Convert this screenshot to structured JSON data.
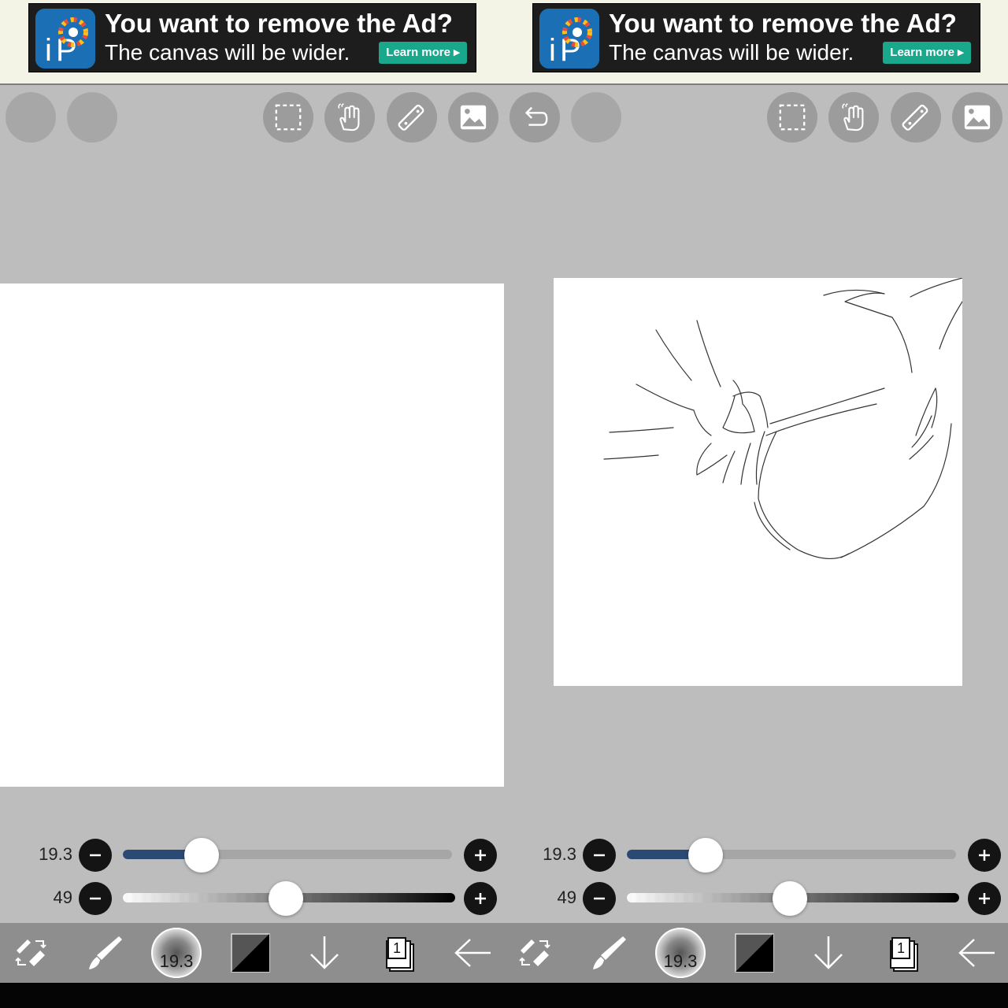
{
  "panes": [
    {
      "id": "left",
      "ad": {
        "title": "You want to remove the Ad?",
        "subtitle": "The canvas will be wider.",
        "button": "Learn more ▸"
      },
      "brush_size": "19.3",
      "brush_size_fraction": 0.24,
      "opacity": "49",
      "opacity_fraction": 0.49,
      "brush_preview_label": "19.3",
      "layer_count": "1",
      "canvas_has_drawing": false
    },
    {
      "id": "right",
      "ad": {
        "title": "You want to remove the Ad?",
        "subtitle": "The canvas will be wider.",
        "button": "Learn more ▸"
      },
      "brush_size": "19.3",
      "brush_size_fraction": 0.24,
      "opacity": "49",
      "opacity_fraction": 0.49,
      "brush_preview_label": "19.3",
      "layer_count": "1",
      "canvas_has_drawing": true
    }
  ],
  "colors": {
    "background": "#bdbdbd",
    "toolbar_button": "#9c9c9c",
    "slider_fill": "#2b4a73",
    "bottom_bar": "#8e8e8e",
    "ad_button": "#19a88c"
  },
  "icons": {
    "top_toolbar": [
      "menu-icon",
      "layers-panel-icon",
      "selection-icon",
      "hand-tool-icon",
      "ruler-icon",
      "image-icon",
      "undo-icon",
      "redo-icon"
    ],
    "bottom_toolbar": [
      "swap-tools-icon",
      "brush-icon",
      "brush-size-icon",
      "color-icon",
      "download-icon",
      "layers-icon",
      "back-icon"
    ]
  }
}
